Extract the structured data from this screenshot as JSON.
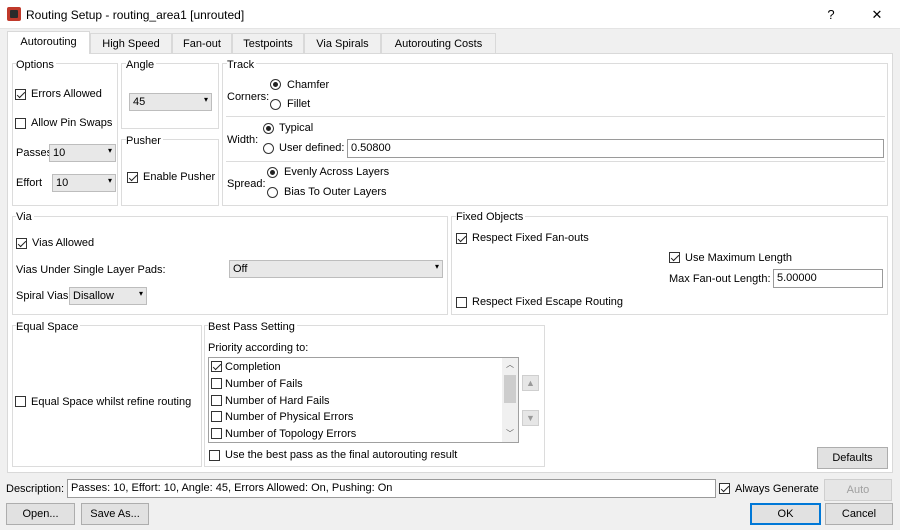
{
  "window": {
    "title": "Routing Setup - routing_area1 [unrouted]",
    "help": "?",
    "close": "✕"
  },
  "tabs": [
    "Autorouting",
    "High Speed",
    "Fan-out",
    "Testpoints",
    "Via Spirals",
    "Autorouting Costs"
  ],
  "options": {
    "title": "Options",
    "errors_allowed": "Errors Allowed",
    "allow_pin_swaps": "Allow Pin Swaps",
    "passes_label": "Passes",
    "passes_value": "10",
    "effort_label": "Effort",
    "effort_value": "10"
  },
  "angle": {
    "title": "Angle",
    "value": "45"
  },
  "pusher": {
    "title": "Pusher",
    "enable": "Enable Pusher"
  },
  "track": {
    "title": "Track",
    "corners_label": "Corners:",
    "chamfer": "Chamfer",
    "fillet": "Fillet",
    "width_label": "Width:",
    "typical": "Typical",
    "user_defined": "User defined:",
    "user_defined_value": "0.50800",
    "spread_label": "Spread:",
    "evenly": "Evenly Across Layers",
    "bias": "Bias To Outer Layers"
  },
  "via": {
    "title": "Via",
    "vias_allowed": "Vias Allowed",
    "under_pads_label": "Vias Under Single Layer Pads:",
    "under_pads_value": "Off",
    "spiral_label": "Spiral Vias",
    "spiral_value": "Disallow"
  },
  "fixed": {
    "title": "Fixed Objects",
    "respect_fanouts": "Respect Fixed Fan-outs",
    "use_max_length": "Use Maximum Length",
    "max_fanout_label": "Max Fan-out Length:",
    "max_fanout_value": "5.00000",
    "respect_escape": "Respect Fixed Escape Routing"
  },
  "equal_space": {
    "title": "Equal Space",
    "option": "Equal Space whilst refine routing"
  },
  "best_pass": {
    "title": "Best Pass Setting",
    "priority_label": "Priority according to:",
    "items": [
      "Completion",
      "Number of Fails",
      "Number of Hard Fails",
      "Number of Physical Errors",
      "Number of Topology Errors"
    ],
    "use_best": "Use the best pass as the final autorouting result"
  },
  "bottom": {
    "defaults": "Defaults",
    "description_label": "Description:",
    "description_value": "Passes: 10, Effort: 10, Angle: 45, Errors Allowed: On, Pushing: On",
    "always_generate": "Always Generate",
    "auto": "Auto",
    "open": "Open...",
    "save_as": "Save As...",
    "ok": "OK",
    "cancel": "Cancel"
  }
}
